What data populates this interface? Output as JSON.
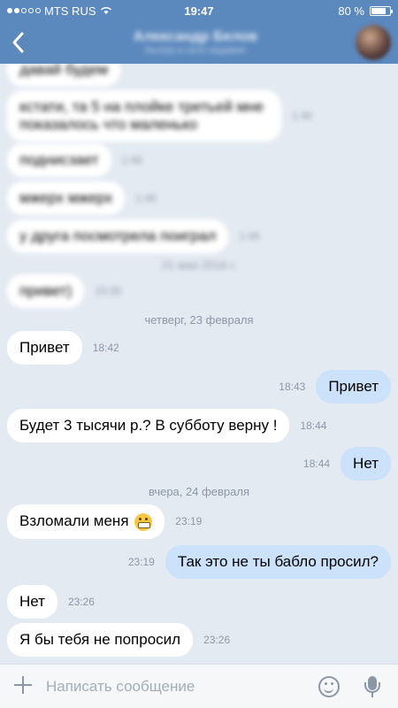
{
  "status": {
    "carrier": "MTS RUS",
    "time": "19:47",
    "battery": "80 %",
    "battery_level": 0.8
  },
  "header": {
    "title": "Александр Белов",
    "subtitle": "был(а) в сети недавно"
  },
  "chat": {
    "blurred_messages": [
      {
        "text": "давай будем",
        "time": ""
      },
      {
        "text": "кстати, та 5 на плойке третьей мне показалось что маленько",
        "time": "1:45"
      },
      {
        "text": "поднисзает",
        "time": "1:46"
      },
      {
        "text": "мжерх мжерх",
        "time": "1:46"
      },
      {
        "text": "у друга посмотрела поиграл",
        "time": "1:46"
      },
      {
        "text": "привет)",
        "time": "23:35"
      }
    ],
    "blurred_date": "21 мая 2016 г.",
    "date_1": "четверг, 23 февраля",
    "date_2": "вчера, 24 февраля",
    "messages": [
      {
        "dir": "in",
        "text": "Привет",
        "time": "18:42"
      },
      {
        "dir": "out",
        "text": "Привет",
        "time": "18:43"
      },
      {
        "dir": "in",
        "text": "Будет 3 тысячи р.? В субботу верну !",
        "time": "18:44"
      },
      {
        "dir": "out",
        "text": "Нет",
        "time": "18:44"
      },
      {
        "dir": "in",
        "text": "Взломали меня",
        "time": "23:19",
        "emoji": "grimacing-face"
      },
      {
        "dir": "out",
        "text": "Так это не ты бабло просил?",
        "time": "23:19"
      },
      {
        "dir": "in",
        "text": "Нет",
        "time": "23:26"
      },
      {
        "dir": "in",
        "text": "Я бы тебя не попросил",
        "time": "23:26"
      }
    ]
  },
  "input": {
    "placeholder": "Написать сообщение"
  },
  "colors": {
    "header": "#5b88bd",
    "background": "#e4eaf2",
    "incoming_bubble": "#ffffff",
    "outgoing_bubble": "#cce2fb"
  }
}
